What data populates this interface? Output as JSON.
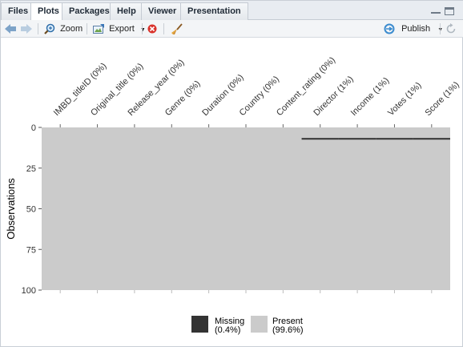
{
  "tabs": [
    {
      "label": "Files",
      "active": false
    },
    {
      "label": "Plots",
      "active": true
    },
    {
      "label": "Packages",
      "active": false
    },
    {
      "label": "Help",
      "active": false
    },
    {
      "label": "Viewer",
      "active": false
    },
    {
      "label": "Presentation",
      "active": false
    }
  ],
  "toolbar": {
    "zoom_label": "Zoom",
    "export_label": "Export",
    "publish_label": "Publish"
  },
  "colors": {
    "present": "#cbcbcb",
    "missing": "#333333",
    "tab_strip": "#e8ecf1"
  },
  "chart_data": {
    "type": "heatmap",
    "title": "",
    "xlabel": "",
    "ylabel": "Observations",
    "ylim": [
      0,
      100
    ],
    "y_ticks": [
      "0",
      "25",
      "50",
      "75",
      "100"
    ],
    "columns": [
      {
        "label": "IMBD_titleID (0%)",
        "missing_pct": 0
      },
      {
        "label": "Original_title (0%)",
        "missing_pct": 0
      },
      {
        "label": "Release_year (0%)",
        "missing_pct": 0
      },
      {
        "label": "Genre (0%)",
        "missing_pct": 0
      },
      {
        "label": "Duration (0%)",
        "missing_pct": 0
      },
      {
        "label": "Country (0%)",
        "missing_pct": 0
      },
      {
        "label": "Content_rating (0%)",
        "missing_pct": 0
      },
      {
        "label": "Director (1%)",
        "missing_pct": 1
      },
      {
        "label": "Income (1%)",
        "missing_pct": 1
      },
      {
        "label": "Votes (1%)",
        "missing_pct": 1
      },
      {
        "label": "Score (1%)",
        "missing_pct": 1
      }
    ],
    "missing_row": 7,
    "legend": [
      {
        "name": "Missing",
        "pct": "(0.4%)",
        "color": "#333333"
      },
      {
        "name": "Present",
        "pct": "(99.6%)",
        "color": "#cbcbcb"
      }
    ],
    "legend_position": "bottom"
  }
}
